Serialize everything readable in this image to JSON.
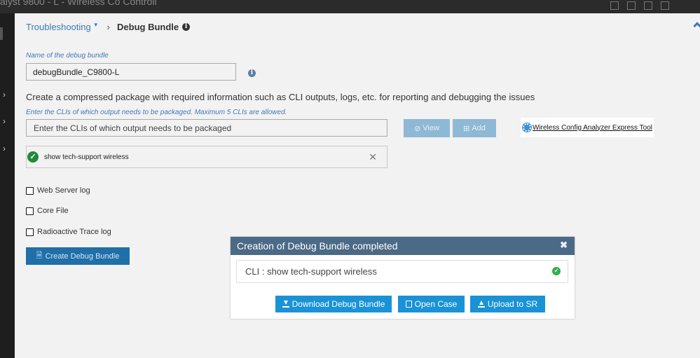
{
  "topbar": {
    "title": "alyst 9800 - L - Wireless Co Controll"
  },
  "breadcrumb": {
    "parent": "Troubleshooting",
    "current": "Debug Bundle"
  },
  "bundle_name": {
    "label": "Name of the debug bundle",
    "value": "debugBundle_C9800-L"
  },
  "description": "Create a compressed package with required information such as CLI outputs, logs, etc. for reporting and debugging the issues",
  "cli": {
    "hint": "Enter the CLIs of which output needs to be packaged. Maximum 5 CLIs are allowed.",
    "placeholder": "Enter the CLIs of which output needs to be packaged",
    "view_label": "View",
    "add_label": "Add",
    "items": [
      "show tech-support wireless"
    ]
  },
  "tool_link": "Wireless Config Analyzer Express Tool",
  "options": {
    "web_server_log": "Web Server log",
    "core_file": "Core File",
    "radioactive_trace_log": "Radioactive Trace log"
  },
  "create_label": "Create Debug Bundle",
  "modal": {
    "title": "Creation of Debug Bundle completed",
    "cli_line": "CLI : show tech-support wireless",
    "download_label": "Download Debug Bundle",
    "open_case_label": "Open Case",
    "upload_label": "Upload to SR"
  },
  "colors": {
    "link": "#3d7ab8",
    "primary_button": "#1f6fa8",
    "modal_header": "#4b6a86",
    "modal_button": "#1a92d6",
    "success": "#2fb24a"
  }
}
